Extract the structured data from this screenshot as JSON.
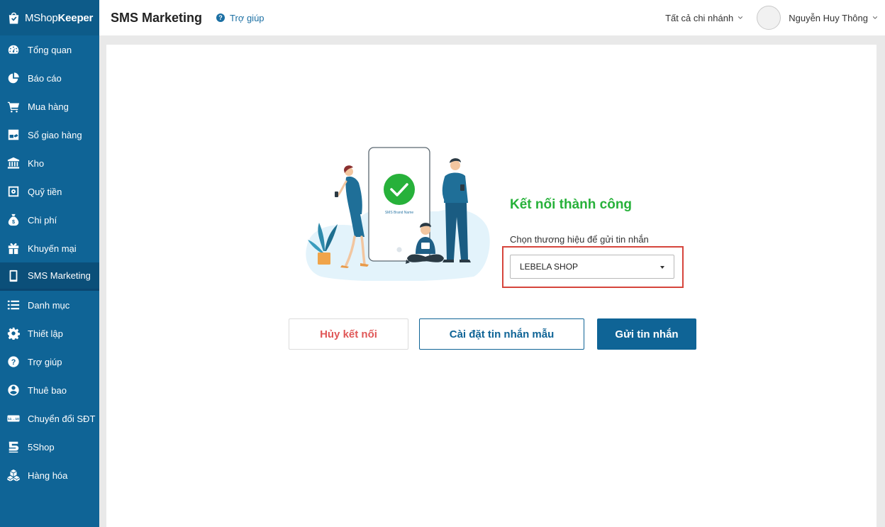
{
  "app": {
    "brand_prefix": "MShop",
    "brand_suffix": "Keeper"
  },
  "sidebar": {
    "items": [
      {
        "label": "Tổng quan",
        "icon": "dashboard-icon"
      },
      {
        "label": "Báo cáo",
        "icon": "pie-chart-icon"
      },
      {
        "label": "Mua hàng",
        "icon": "cart-icon"
      },
      {
        "label": "Sổ giao hàng",
        "icon": "delivery-icon"
      },
      {
        "label": "Kho",
        "icon": "warehouse-icon"
      },
      {
        "label": "Quỹ tiền",
        "icon": "safe-icon"
      },
      {
        "label": "Chi phí",
        "icon": "expense-icon"
      },
      {
        "label": "Khuyến mại",
        "icon": "gift-icon"
      },
      {
        "label": "SMS Marketing",
        "icon": "phone-icon",
        "active": true
      },
      {
        "label": "Danh mục",
        "icon": "list-icon"
      },
      {
        "label": "Thiết lập",
        "icon": "gear-icon"
      },
      {
        "label": "Trợ giúp",
        "icon": "question-icon"
      },
      {
        "label": "Thuê bao",
        "icon": "user-icon"
      },
      {
        "label": "Chuyển đổi SĐT",
        "icon": "convert-phone-icon"
      },
      {
        "label": "5Shop",
        "icon": "5shop-icon"
      },
      {
        "label": "Hàng hóa",
        "icon": "boxes-icon"
      }
    ]
  },
  "header": {
    "title": "SMS Marketing",
    "help_label": "Trợ giúp",
    "branch_label": "Tất cả chi nhánh",
    "user_name": "Nguyễn Huy Thông"
  },
  "main": {
    "phone_screen_text": "SMS Brand Name",
    "success_title": "Kết nối thành công",
    "select_label": "Chọn thương hiệu để gửi tin nhắn",
    "selected_brand": "LEBELA SHOP",
    "buttons": {
      "disconnect": "Hủy kết nối",
      "template": "Cài đặt tin nhắn mẫu",
      "send": "Gửi tin nhắn"
    }
  },
  "colors": {
    "sidebar": "#0f6496",
    "success": "#27b13a",
    "danger": "#e05757",
    "highlight": "#d6453c"
  }
}
